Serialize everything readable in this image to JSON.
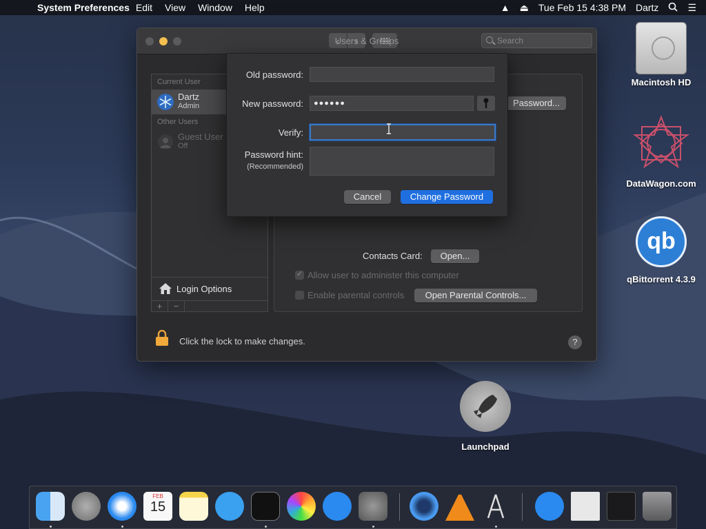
{
  "menubar": {
    "app_name": "System Preferences",
    "items": [
      "Edit",
      "View",
      "Window",
      "Help"
    ],
    "clock": "Tue Feb 15  4:38 PM",
    "user": "Dartz"
  },
  "window": {
    "title": "Users & Groups",
    "search_placeholder": "Search",
    "sidebar": {
      "current_user_header": "Current User",
      "current_user": {
        "name": "Dartz",
        "role": "Admin"
      },
      "other_users_header": "Other Users",
      "guest_user": {
        "name": "Guest User",
        "role": "Off"
      },
      "login_options": "Login Options",
      "add": "+",
      "remove": "−"
    },
    "main": {
      "password_button": "Password...",
      "contacts_card_label": "Contacts Card:",
      "open_button": "Open...",
      "allow_admin": "Allow user to administer this computer",
      "parental_controls": "Enable parental controls",
      "open_parental_button": "Open Parental Controls..."
    },
    "lock_text": "Click the lock to make changes.",
    "help": "?"
  },
  "sheet": {
    "old_password_label": "Old password:",
    "old_password_value": "",
    "new_password_label": "New password:",
    "new_password_value": "●●●●●●",
    "verify_label": "Verify:",
    "verify_value": "",
    "hint_label": "Password hint:",
    "hint_sub": "(Recommended)",
    "hint_value": "",
    "cancel": "Cancel",
    "change": "Change Password"
  },
  "desktop": {
    "icons": [
      {
        "label": "Macintosh HD"
      },
      {
        "label": "DataWagon.com"
      },
      {
        "label": "qBittorrent 4.3.9",
        "glyph": "qb"
      },
      {
        "label": "Launchpad"
      }
    ]
  },
  "dock": {
    "apps": [
      "Finder",
      "Launchpad",
      "Safari",
      "Calendar",
      "Notes",
      "Messages",
      "Terminal",
      "Photos",
      "App Store",
      "System Preferences",
      "QuickTime Player",
      "VLC",
      "Automator",
      "App Store",
      "Movie",
      "Screen",
      "Trash"
    ],
    "calendar_month": "FEB",
    "calendar_day": "15"
  }
}
